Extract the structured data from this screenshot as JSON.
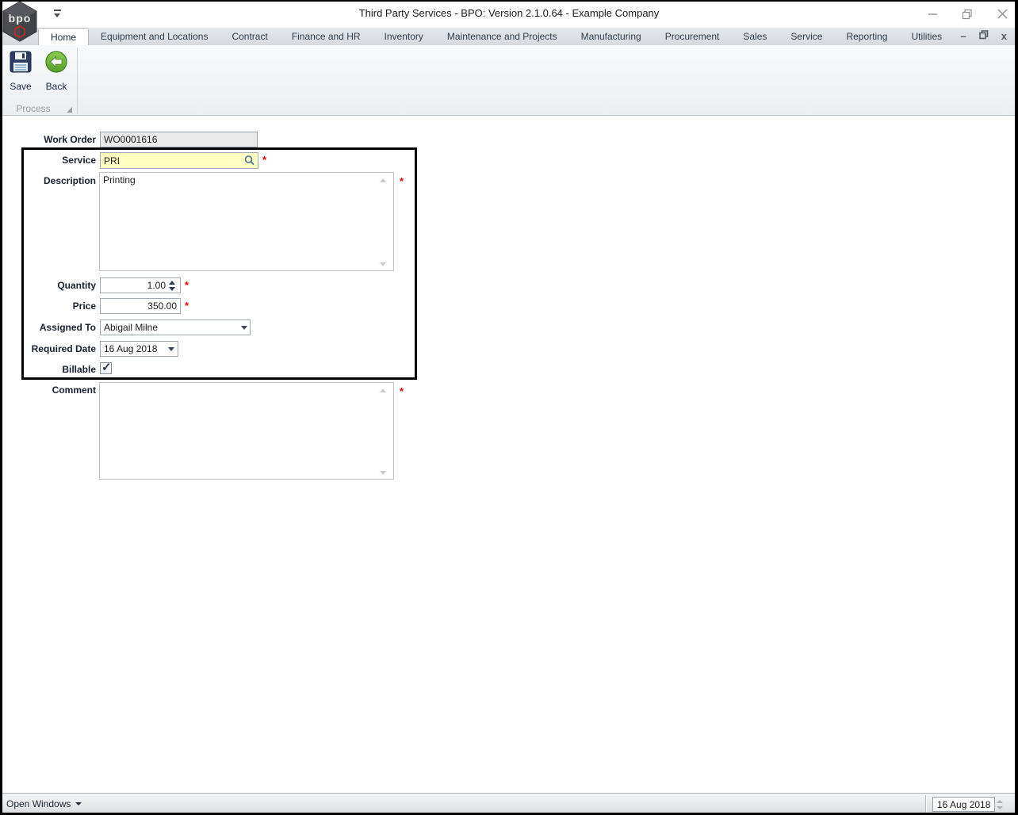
{
  "window": {
    "title": "Third Party Services - BPO: Version 2.1.0.64 - Example Company",
    "logo_text": "bpo"
  },
  "ribbon": {
    "tabs": [
      {
        "label": "Home",
        "selected": true
      },
      {
        "label": "Equipment and Locations"
      },
      {
        "label": "Contract"
      },
      {
        "label": "Finance and HR"
      },
      {
        "label": "Inventory"
      },
      {
        "label": "Maintenance and Projects"
      },
      {
        "label": "Manufacturing"
      },
      {
        "label": "Procurement"
      },
      {
        "label": "Sales"
      },
      {
        "label": "Service"
      },
      {
        "label": "Reporting"
      },
      {
        "label": "Utilities"
      }
    ],
    "save_label": "Save",
    "back_label": "Back",
    "group_label": "Process"
  },
  "form": {
    "required_marker": "*",
    "work_order": {
      "label": "Work Order",
      "value": "WO0001616"
    },
    "service": {
      "label": "Service",
      "value": "PRI"
    },
    "description": {
      "label": "Description",
      "value": "Printing"
    },
    "quantity": {
      "label": "Quantity",
      "value": "1.00"
    },
    "price": {
      "label": "Price",
      "value": "350.00"
    },
    "assigned_to": {
      "label": "Assigned To",
      "value": "Abigail Milne"
    },
    "required_date": {
      "label": "Required Date",
      "value": "16 Aug 2018"
    },
    "billable": {
      "label": "Billable",
      "checkmark": "✓"
    },
    "comment": {
      "label": "Comment",
      "value": ""
    }
  },
  "status_bar": {
    "open_windows_label": "Open Windows",
    "date_value": "16 Aug 2018"
  },
  "colors": {
    "lookup_field_bg": "#FFFFC2",
    "readonly_field_bg": "#E9E9E9",
    "required_asterisk": "#E60000",
    "highlight_box_border": "#000000",
    "back_button_green": "#6CB33F",
    "save_icon_navy": "#2E3D63"
  }
}
